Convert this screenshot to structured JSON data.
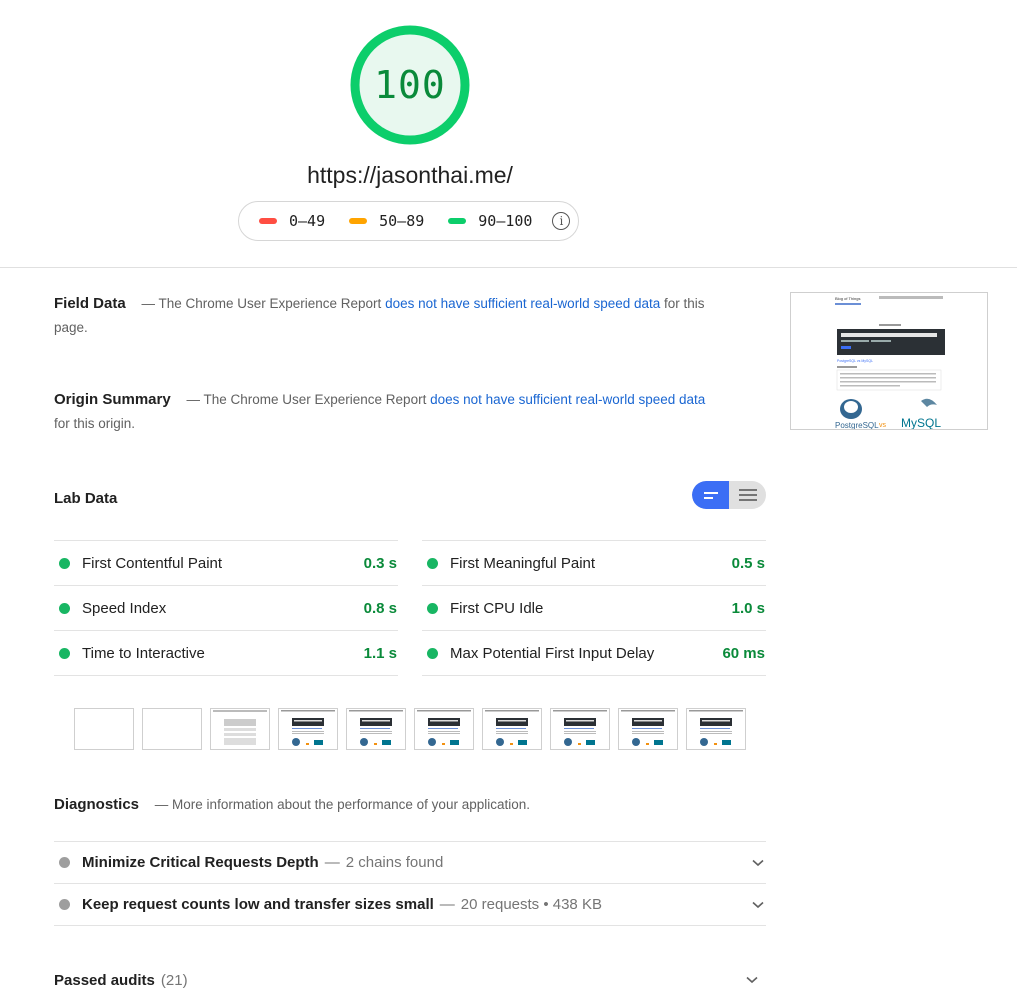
{
  "score": {
    "value": "100",
    "color": "#0cce6b",
    "fill": "#e8f8ef",
    "level": 1.0
  },
  "url": "https://jasonthai.me/",
  "legend": {
    "ranges": [
      {
        "label": "0–49",
        "color": "#ff4e42"
      },
      {
        "label": "50–89",
        "color": "#ffa400"
      },
      {
        "label": "90–100",
        "color": "#0cce6b"
      }
    ],
    "info_icon": "info-icon"
  },
  "field_data": {
    "title": "Field Data",
    "prefix": "— The Chrome User Experience Report",
    "link": "does not have sufficient real-world speed data",
    "suffix": "for this page."
  },
  "origin_summary": {
    "title": "Origin Summary",
    "prefix": "— The Chrome User Experience Report",
    "link": "does not have sufficient real-world speed data",
    "suffix": "for this origin."
  },
  "thumbnail": {
    "site_title": "Blog of Things",
    "post_title": "PostgreSQL vs MySQL",
    "logo_left": "PostgreSQL",
    "vs": "vs",
    "logo_right": "MySQL"
  },
  "lab_data": {
    "title": "Lab Data",
    "metrics_left": [
      {
        "name": "First Contentful Paint",
        "value": "0.3 s"
      },
      {
        "name": "Speed Index",
        "value": "0.8 s"
      },
      {
        "name": "Time to Interactive",
        "value": "1.1 s"
      }
    ],
    "metrics_right": [
      {
        "name": "First Meaningful Paint",
        "value": "0.5 s"
      },
      {
        "name": "First CPU Idle",
        "value": "1.0 s"
      },
      {
        "name": "Max Potential First Input Delay",
        "value": "60 ms"
      }
    ],
    "filmstrip_frames": [
      "blank",
      "blank",
      "skeleton",
      "loaded",
      "loaded",
      "loaded",
      "loaded",
      "loaded",
      "loaded",
      "loaded"
    ]
  },
  "diagnostics": {
    "title": "Diagnostics",
    "subtitle": "— More information about the performance of your application.",
    "audits": [
      {
        "name": "Minimize Critical Requests Depth",
        "detail": "2 chains found"
      },
      {
        "name": "Keep request counts low and transfer sizes small",
        "detail": "20 requests • 438 KB"
      }
    ]
  },
  "passed_audits": {
    "label": "Passed audits",
    "count": "(21)"
  }
}
